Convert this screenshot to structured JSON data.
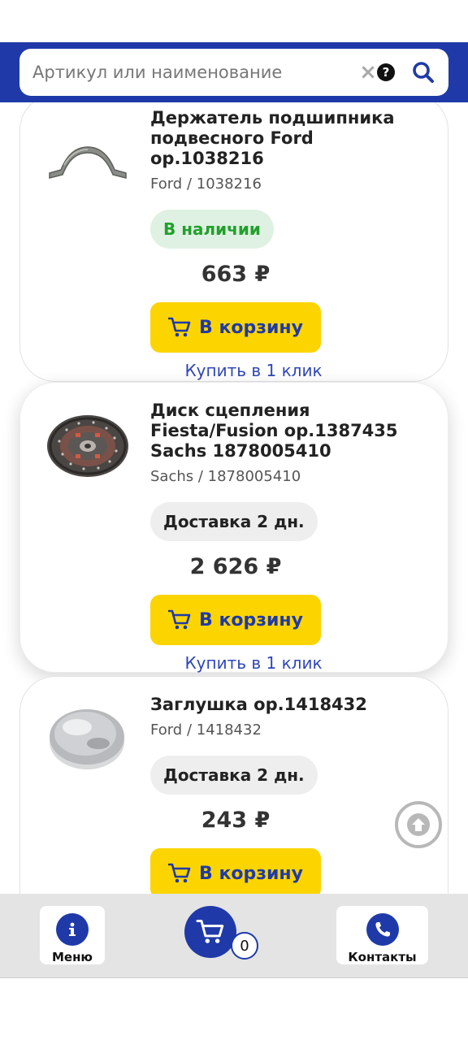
{
  "search": {
    "placeholder": "Артикул или наименование",
    "value": ""
  },
  "products": [
    {
      "title": "Держатель подшипника подвесного Ford ор.1038216",
      "brand_article": "Ford / 1038216",
      "availability": "В наличии",
      "availability_status": "in-stock",
      "price": "663 ₽",
      "cart_label": "В корзину",
      "one_click_label": "Купить в 1 клик"
    },
    {
      "title": "Диск сцепления Fiesta/Fusion ор.1387435 Sachs 1878005410",
      "brand_article": "Sachs / 1878005410",
      "availability": "Доставка 2 дн.",
      "availability_status": "delivery",
      "price": "2 626 ₽",
      "cart_label": "В корзину",
      "one_click_label": "Купить в 1 клик"
    },
    {
      "title": "Заглушка ор.1418432",
      "brand_article": "Ford / 1418432",
      "availability": "Доставка 2 дн.",
      "availability_status": "delivery",
      "price": "243 ₽",
      "cart_label": "В корзину",
      "one_click_label": ""
    }
  ],
  "bottom_nav": {
    "menu_label": "Меню",
    "menu_icon": "info-icon",
    "cart_icon": "cart-icon",
    "cart_count": "0",
    "contacts_label": "Контакты",
    "contacts_icon": "phone-icon"
  },
  "colors": {
    "brand_blue": "#1f3aa8",
    "button_yellow": "#fcd400",
    "in_stock_green": "#22a02c",
    "link_blue": "#2f47b8"
  }
}
